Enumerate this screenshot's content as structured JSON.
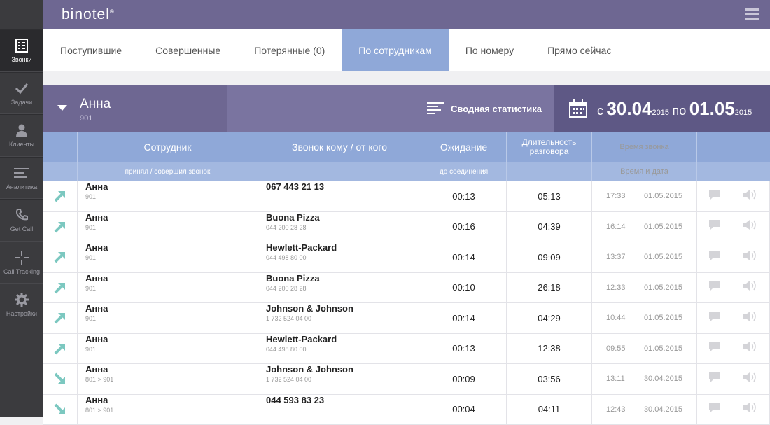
{
  "app": {
    "logo": "binotel"
  },
  "sidebar": {
    "items": [
      {
        "label": "Звонки",
        "icon": "phonebook-icon",
        "active": true
      },
      {
        "label": "Задачи",
        "icon": "check-icon",
        "active": false
      },
      {
        "label": "Клиенты",
        "icon": "user-icon",
        "active": false
      },
      {
        "label": "Аналитика",
        "icon": "bars-icon",
        "active": false
      },
      {
        "label": "Get Call",
        "icon": "phone-icon",
        "active": false
      },
      {
        "label": "Call Tracking",
        "icon": "crosshair-icon",
        "active": false
      },
      {
        "label": "Настройки",
        "icon": "gear-icon",
        "active": false
      }
    ]
  },
  "tabs": [
    {
      "label": "Поступившие",
      "active": false
    },
    {
      "label": "Совершенные",
      "active": false
    },
    {
      "label": "Потерянные (0)",
      "active": false
    },
    {
      "label": "По сотрудникам",
      "active": true
    },
    {
      "label": "По номеру",
      "active": false
    },
    {
      "label": "Прямо сейчас",
      "active": false
    }
  ],
  "employee": {
    "name": "Анна",
    "ext": "901"
  },
  "summary_label": "Сводная статистика",
  "date_range": {
    "from_word": "с",
    "from_day": "30.04",
    "from_year": "2015",
    "to_word": "по",
    "to_day": "01.05",
    "to_year": "2015"
  },
  "table": {
    "headers": {
      "employee": "Сотрудник",
      "contact": "Звонок кому / от кого",
      "wait": "Ожидание",
      "duration": "Длительность разговора",
      "time": "Время звонка"
    },
    "subheaders": {
      "employee": "принял / совершил звонок",
      "wait": "до соединения",
      "time": "Время и дата"
    },
    "rows": [
      {
        "dir": "out",
        "name": "Анна",
        "ext": "901",
        "contact": "067 443 21 13",
        "contact_sub": "",
        "wait": "00:13",
        "duration": "05:13",
        "time": "17:33",
        "date": "01.05.2015"
      },
      {
        "dir": "out",
        "name": "Анна",
        "ext": "901",
        "contact": "Buona Pizza",
        "contact_sub": "044 200 28 28",
        "wait": "00:16",
        "duration": "04:39",
        "time": "16:14",
        "date": "01.05.2015"
      },
      {
        "dir": "out",
        "name": "Анна",
        "ext": "901",
        "contact": "Hewlett-Packard",
        "contact_sub": "044 498 80 00",
        "wait": "00:14",
        "duration": "09:09",
        "time": "13:37",
        "date": "01.05.2015"
      },
      {
        "dir": "out",
        "name": "Анна",
        "ext": "901",
        "contact": "Buona Pizza",
        "contact_sub": "044 200 28 28",
        "wait": "00:10",
        "duration": "26:18",
        "time": "12:33",
        "date": "01.05.2015"
      },
      {
        "dir": "out",
        "name": "Анна",
        "ext": "901",
        "contact": "Johnson & Johnson",
        "contact_sub": "1 732 524 04 00",
        "wait": "00:14",
        "duration": "04:29",
        "time": "10:44",
        "date": "01.05.2015"
      },
      {
        "dir": "out",
        "name": "Анна",
        "ext": "901",
        "contact": "Hewlett-Packard",
        "contact_sub": "044 498 80 00",
        "wait": "00:13",
        "duration": "12:38",
        "time": "09:55",
        "date": "01.05.2015"
      },
      {
        "dir": "in",
        "name": "Анна",
        "ext": "801 > 901",
        "contact": "Johnson & Johnson",
        "contact_sub": "1 732 524 04 00",
        "wait": "00:09",
        "duration": "03:56",
        "time": "13:11",
        "date": "30.04.2015"
      },
      {
        "dir": "in",
        "name": "Анна",
        "ext": "801 > 901",
        "contact": "044 593 83 23",
        "contact_sub": "",
        "wait": "00:04",
        "duration": "04:11",
        "time": "12:43",
        "date": "30.04.2015"
      }
    ]
  },
  "colors": {
    "accent": "#8fa8d8",
    "header": "#6e6792",
    "arrow": "#7cc8c0"
  }
}
